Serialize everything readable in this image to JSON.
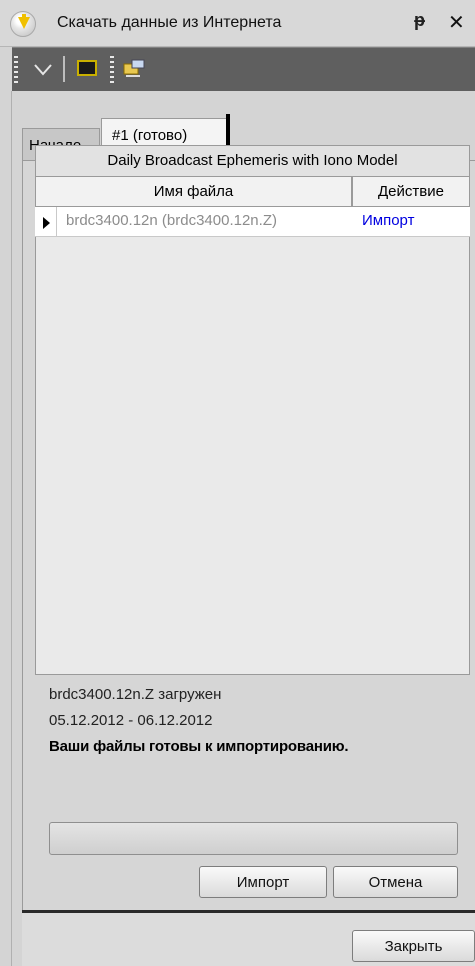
{
  "window": {
    "title": "Скачать данные из Интернета",
    "pin_glyph": "ᵽ",
    "close_glyph": "✕"
  },
  "toolbar": {
    "icons": [
      "dropdown-icon",
      "monitor-icon",
      "connect-icon"
    ]
  },
  "tabs": [
    {
      "label": "Начало",
      "active": false
    },
    {
      "label": "#1 (готово)",
      "active": true
    }
  ],
  "grid": {
    "title": "Daily Broadcast Ephemeris with Iono Model",
    "columns": [
      "Имя файла",
      "Действие"
    ],
    "rows": [
      {
        "file": "brdc3400.12n  (brdc3400.12n.Z)",
        "action": "Импорт"
      }
    ]
  },
  "status": {
    "line1": "brdc3400.12n.Z загружен",
    "line2": "05.12.2012 - 06.12.2012",
    "line3": "Ваши файлы готовы к импортированию."
  },
  "buttons": {
    "import": "Импорт",
    "cancel": "Отмена",
    "close": "Закрыть"
  },
  "colors": {
    "toolbar": "#5f5f5f",
    "link": "#0000e0",
    "file_text": "#8c8c8c"
  }
}
